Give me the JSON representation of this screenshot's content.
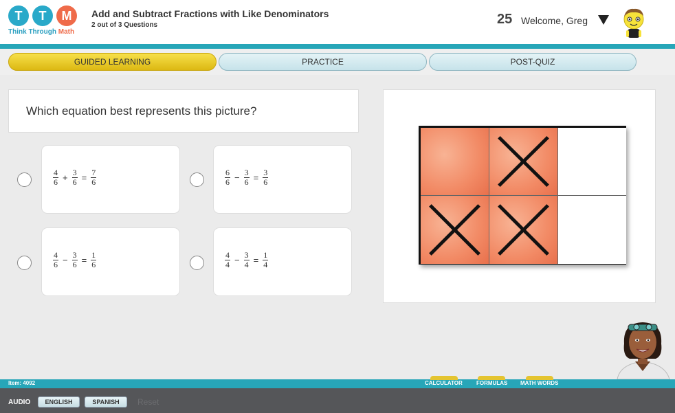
{
  "header": {
    "logo_letters": [
      "T",
      "T",
      "M"
    ],
    "logo_tag_1": "Think",
    "logo_tag_2": "Through",
    "logo_tag_3": "Math",
    "lesson_title": "Add and Subtract Fractions with Like Denominators",
    "lesson_progress": "2 out of 3 Questions",
    "points": "25",
    "welcome": "Welcome, Greg"
  },
  "tabs": [
    {
      "label": "GUIDED LEARNING",
      "active": true
    },
    {
      "label": "PRACTICE",
      "active": false
    },
    {
      "label": "POST-QUIZ",
      "active": false
    }
  ],
  "question": {
    "text": "Which equation best represents this picture?"
  },
  "answers": [
    {
      "a_num": "4",
      "a_den": "6",
      "op": "+",
      "b_num": "3",
      "b_den": "6",
      "eq": "=",
      "c_num": "7",
      "c_den": "6"
    },
    {
      "a_num": "6",
      "a_den": "6",
      "op": "−",
      "b_num": "3",
      "b_den": "6",
      "eq": "=",
      "c_num": "3",
      "c_den": "6"
    },
    {
      "a_num": "4",
      "a_den": "6",
      "op": "−",
      "b_num": "3",
      "b_den": "6",
      "eq": "=",
      "c_num": "1",
      "c_den": "6"
    },
    {
      "a_num": "4",
      "a_den": "4",
      "op": "−",
      "b_num": "3",
      "b_den": "4",
      "eq": "=",
      "c_num": "1",
      "c_den": "4"
    }
  ],
  "picture": {
    "rows": 2,
    "cols": 3,
    "cells": [
      "shaded",
      "shaded-x",
      "blank",
      "shaded-x",
      "shaded-x",
      "blank"
    ],
    "shade_color": "#f28a65"
  },
  "status": {
    "item": "Item: 4092",
    "tools": [
      "CALCULATOR",
      "FORMULAS",
      "MATH WORDS"
    ]
  },
  "footer": {
    "audio": "AUDIO",
    "english": "ENGLISH",
    "spanish": "SPANISH",
    "reset": "Reset"
  },
  "colors": {
    "accent": "#27a6b8",
    "active_tab": "#f2d52b",
    "logo_blue": "#29a9c9",
    "logo_orange": "#ef6b4a"
  }
}
